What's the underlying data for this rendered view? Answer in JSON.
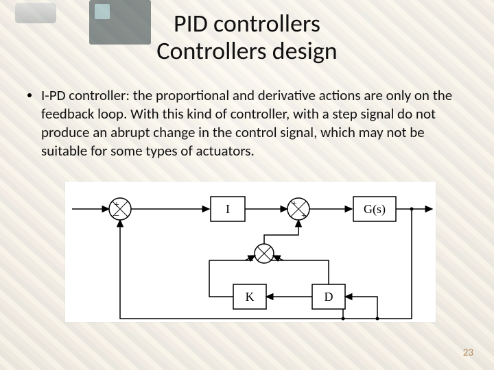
{
  "title_line1": "PID controllers",
  "title_line2": "Controllers design",
  "bullet_text": "I-PD controller: the proportional and derivative actions are only on the feedback loop. With this kind of controller, with a step signal do not produce an abrupt change in the control signal, which may not be suitable for some types of actuators.",
  "diagram": {
    "block_I": "I",
    "block_K": "K",
    "block_D": "D",
    "block_G": "G(s)",
    "sum1_top": "+",
    "sum1_bottom": "−",
    "sum2_top": "+",
    "sum2_bottom": "+"
  },
  "page_number": "23"
}
